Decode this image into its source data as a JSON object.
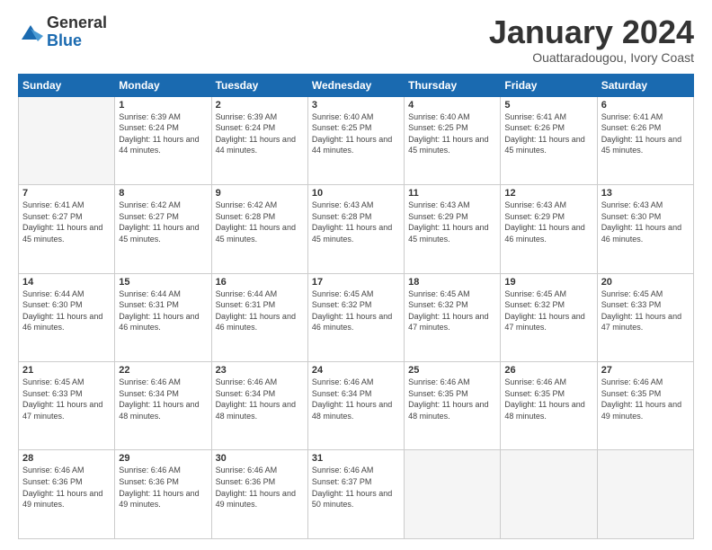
{
  "header": {
    "logo_general": "General",
    "logo_blue": "Blue",
    "month_title": "January 2024",
    "subtitle": "Ouattaradougou, Ivory Coast"
  },
  "weekdays": [
    "Sunday",
    "Monday",
    "Tuesday",
    "Wednesday",
    "Thursday",
    "Friday",
    "Saturday"
  ],
  "weeks": [
    [
      {
        "day": "",
        "sunrise": "",
        "sunset": "",
        "daylight": "",
        "empty": true
      },
      {
        "day": "1",
        "sunrise": "Sunrise: 6:39 AM",
        "sunset": "Sunset: 6:24 PM",
        "daylight": "Daylight: 11 hours and 44 minutes.",
        "empty": false
      },
      {
        "day": "2",
        "sunrise": "Sunrise: 6:39 AM",
        "sunset": "Sunset: 6:24 PM",
        "daylight": "Daylight: 11 hours and 44 minutes.",
        "empty": false
      },
      {
        "day": "3",
        "sunrise": "Sunrise: 6:40 AM",
        "sunset": "Sunset: 6:25 PM",
        "daylight": "Daylight: 11 hours and 44 minutes.",
        "empty": false
      },
      {
        "day": "4",
        "sunrise": "Sunrise: 6:40 AM",
        "sunset": "Sunset: 6:25 PM",
        "daylight": "Daylight: 11 hours and 45 minutes.",
        "empty": false
      },
      {
        "day": "5",
        "sunrise": "Sunrise: 6:41 AM",
        "sunset": "Sunset: 6:26 PM",
        "daylight": "Daylight: 11 hours and 45 minutes.",
        "empty": false
      },
      {
        "day": "6",
        "sunrise": "Sunrise: 6:41 AM",
        "sunset": "Sunset: 6:26 PM",
        "daylight": "Daylight: 11 hours and 45 minutes.",
        "empty": false
      }
    ],
    [
      {
        "day": "7",
        "sunrise": "Sunrise: 6:41 AM",
        "sunset": "Sunset: 6:27 PM",
        "daylight": "Daylight: 11 hours and 45 minutes.",
        "empty": false
      },
      {
        "day": "8",
        "sunrise": "Sunrise: 6:42 AM",
        "sunset": "Sunset: 6:27 PM",
        "daylight": "Daylight: 11 hours and 45 minutes.",
        "empty": false
      },
      {
        "day": "9",
        "sunrise": "Sunrise: 6:42 AM",
        "sunset": "Sunset: 6:28 PM",
        "daylight": "Daylight: 11 hours and 45 minutes.",
        "empty": false
      },
      {
        "day": "10",
        "sunrise": "Sunrise: 6:43 AM",
        "sunset": "Sunset: 6:28 PM",
        "daylight": "Daylight: 11 hours and 45 minutes.",
        "empty": false
      },
      {
        "day": "11",
        "sunrise": "Sunrise: 6:43 AM",
        "sunset": "Sunset: 6:29 PM",
        "daylight": "Daylight: 11 hours and 45 minutes.",
        "empty": false
      },
      {
        "day": "12",
        "sunrise": "Sunrise: 6:43 AM",
        "sunset": "Sunset: 6:29 PM",
        "daylight": "Daylight: 11 hours and 46 minutes.",
        "empty": false
      },
      {
        "day": "13",
        "sunrise": "Sunrise: 6:43 AM",
        "sunset": "Sunset: 6:30 PM",
        "daylight": "Daylight: 11 hours and 46 minutes.",
        "empty": false
      }
    ],
    [
      {
        "day": "14",
        "sunrise": "Sunrise: 6:44 AM",
        "sunset": "Sunset: 6:30 PM",
        "daylight": "Daylight: 11 hours and 46 minutes.",
        "empty": false
      },
      {
        "day": "15",
        "sunrise": "Sunrise: 6:44 AM",
        "sunset": "Sunset: 6:31 PM",
        "daylight": "Daylight: 11 hours and 46 minutes.",
        "empty": false
      },
      {
        "day": "16",
        "sunrise": "Sunrise: 6:44 AM",
        "sunset": "Sunset: 6:31 PM",
        "daylight": "Daylight: 11 hours and 46 minutes.",
        "empty": false
      },
      {
        "day": "17",
        "sunrise": "Sunrise: 6:45 AM",
        "sunset": "Sunset: 6:32 PM",
        "daylight": "Daylight: 11 hours and 46 minutes.",
        "empty": false
      },
      {
        "day": "18",
        "sunrise": "Sunrise: 6:45 AM",
        "sunset": "Sunset: 6:32 PM",
        "daylight": "Daylight: 11 hours and 47 minutes.",
        "empty": false
      },
      {
        "day": "19",
        "sunrise": "Sunrise: 6:45 AM",
        "sunset": "Sunset: 6:32 PM",
        "daylight": "Daylight: 11 hours and 47 minutes.",
        "empty": false
      },
      {
        "day": "20",
        "sunrise": "Sunrise: 6:45 AM",
        "sunset": "Sunset: 6:33 PM",
        "daylight": "Daylight: 11 hours and 47 minutes.",
        "empty": false
      }
    ],
    [
      {
        "day": "21",
        "sunrise": "Sunrise: 6:45 AM",
        "sunset": "Sunset: 6:33 PM",
        "daylight": "Daylight: 11 hours and 47 minutes.",
        "empty": false
      },
      {
        "day": "22",
        "sunrise": "Sunrise: 6:46 AM",
        "sunset": "Sunset: 6:34 PM",
        "daylight": "Daylight: 11 hours and 48 minutes.",
        "empty": false
      },
      {
        "day": "23",
        "sunrise": "Sunrise: 6:46 AM",
        "sunset": "Sunset: 6:34 PM",
        "daylight": "Daylight: 11 hours and 48 minutes.",
        "empty": false
      },
      {
        "day": "24",
        "sunrise": "Sunrise: 6:46 AM",
        "sunset": "Sunset: 6:34 PM",
        "daylight": "Daylight: 11 hours and 48 minutes.",
        "empty": false
      },
      {
        "day": "25",
        "sunrise": "Sunrise: 6:46 AM",
        "sunset": "Sunset: 6:35 PM",
        "daylight": "Daylight: 11 hours and 48 minutes.",
        "empty": false
      },
      {
        "day": "26",
        "sunrise": "Sunrise: 6:46 AM",
        "sunset": "Sunset: 6:35 PM",
        "daylight": "Daylight: 11 hours and 48 minutes.",
        "empty": false
      },
      {
        "day": "27",
        "sunrise": "Sunrise: 6:46 AM",
        "sunset": "Sunset: 6:35 PM",
        "daylight": "Daylight: 11 hours and 49 minutes.",
        "empty": false
      }
    ],
    [
      {
        "day": "28",
        "sunrise": "Sunrise: 6:46 AM",
        "sunset": "Sunset: 6:36 PM",
        "daylight": "Daylight: 11 hours and 49 minutes.",
        "empty": false
      },
      {
        "day": "29",
        "sunrise": "Sunrise: 6:46 AM",
        "sunset": "Sunset: 6:36 PM",
        "daylight": "Daylight: 11 hours and 49 minutes.",
        "empty": false
      },
      {
        "day": "30",
        "sunrise": "Sunrise: 6:46 AM",
        "sunset": "Sunset: 6:36 PM",
        "daylight": "Daylight: 11 hours and 49 minutes.",
        "empty": false
      },
      {
        "day": "31",
        "sunrise": "Sunrise: 6:46 AM",
        "sunset": "Sunset: 6:37 PM",
        "daylight": "Daylight: 11 hours and 50 minutes.",
        "empty": false
      },
      {
        "day": "",
        "sunrise": "",
        "sunset": "",
        "daylight": "",
        "empty": true
      },
      {
        "day": "",
        "sunrise": "",
        "sunset": "",
        "daylight": "",
        "empty": true
      },
      {
        "day": "",
        "sunrise": "",
        "sunset": "",
        "daylight": "",
        "empty": true
      }
    ]
  ]
}
